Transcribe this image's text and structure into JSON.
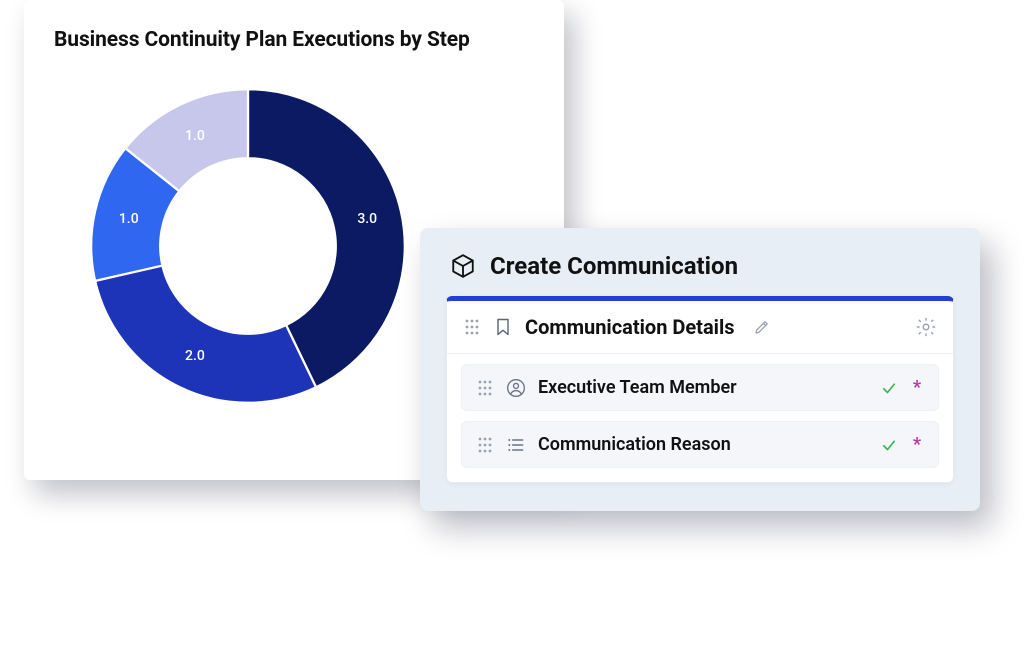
{
  "chart_data": {
    "type": "donut",
    "title": "Business Continuity Plan Executions by Step",
    "series": [
      {
        "value": 3.0,
        "label": "3.0",
        "color": "#0b1a63"
      },
      {
        "value": 2.0,
        "label": "2.0",
        "color": "#1d33b8"
      },
      {
        "value": 1.0,
        "label": "1.0",
        "color": "#3067f0"
      },
      {
        "value": 1.0,
        "label": "1.0",
        "color": "#c7c7ec"
      }
    ],
    "inner_radius_pct": 56,
    "start_angle_deg": -90
  },
  "form": {
    "title": "Create Communication",
    "section_title": "Communication Details",
    "required_marker": "*",
    "fields": [
      {
        "label": "Executive Team Member",
        "icon": "person",
        "valid": true,
        "required": true
      },
      {
        "label": "Communication Reason",
        "icon": "list",
        "valid": true,
        "required": true
      }
    ]
  }
}
